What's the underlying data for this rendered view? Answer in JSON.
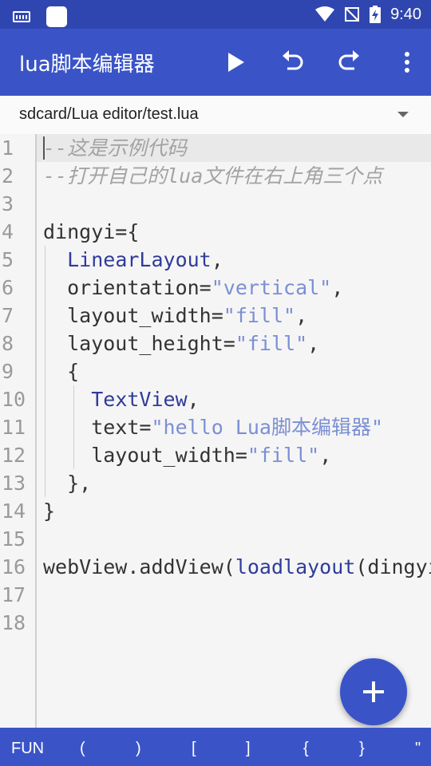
{
  "status_bar": {
    "time": "9:40",
    "icons": [
      "keyboard-icon",
      "app-square-icon",
      "wifi-icon",
      "no-signal-icon",
      "battery-charging-icon"
    ]
  },
  "toolbar": {
    "title": "lua脚本编辑器",
    "actions": [
      "play-icon",
      "undo-icon",
      "redo-icon",
      "more-vert-icon"
    ]
  },
  "file": {
    "path": "sdcard/Lua editor/test.lua"
  },
  "editor": {
    "line_numbers": [
      "1",
      "2",
      "3",
      "4",
      "5",
      "6",
      "7",
      "8",
      "9",
      "10",
      "11",
      "12",
      "13",
      "14",
      "15",
      "16",
      "17",
      "18"
    ],
    "lines": [
      [
        {
          "t": "--这是示例代码",
          "c": "cm"
        }
      ],
      [
        {
          "t": "--打开自己的lua文件在右上角三个点",
          "c": "cm"
        }
      ],
      [],
      [
        {
          "t": "dingyi={",
          "c": ""
        }
      ],
      [
        {
          "t": "  ",
          "c": ""
        },
        {
          "t": "LinearLayout",
          "c": "kw"
        },
        {
          "t": ",",
          "c": ""
        }
      ],
      [
        {
          "t": "  orientation=",
          "c": ""
        },
        {
          "t": "\"vertical\"",
          "c": "str"
        },
        {
          "t": ",",
          "c": ""
        }
      ],
      [
        {
          "t": "  layout_width=",
          "c": ""
        },
        {
          "t": "\"fill\"",
          "c": "str"
        },
        {
          "t": ",",
          "c": ""
        }
      ],
      [
        {
          "t": "  layout_height=",
          "c": ""
        },
        {
          "t": "\"fill\"",
          "c": "str"
        },
        {
          "t": ",",
          "c": ""
        }
      ],
      [
        {
          "t": "  {",
          "c": ""
        }
      ],
      [
        {
          "t": "    ",
          "c": ""
        },
        {
          "t": "TextView",
          "c": "kw"
        },
        {
          "t": ",",
          "c": ""
        }
      ],
      [
        {
          "t": "    text=",
          "c": ""
        },
        {
          "t": "\"hello Lua脚本编辑器\"",
          "c": "str"
        }
      ],
      [
        {
          "t": "    layout_width=",
          "c": ""
        },
        {
          "t": "\"fill\"",
          "c": "str"
        },
        {
          "t": ",",
          "c": ""
        }
      ],
      [
        {
          "t": "  },",
          "c": ""
        }
      ],
      [
        {
          "t": "}",
          "c": ""
        }
      ],
      [],
      [
        {
          "t": "webView.addView(",
          "c": ""
        },
        {
          "t": "loadlayout",
          "c": "kw"
        },
        {
          "t": "(dingyi))",
          "c": ""
        }
      ],
      [],
      []
    ]
  },
  "fab": {
    "icon": "plus-icon"
  },
  "symbol_bar": {
    "keys": [
      "FUN",
      "(",
      ")",
      "[",
      "]",
      "{",
      "}",
      "\""
    ]
  },
  "colors": {
    "primary": "#3a54c8",
    "primary_dark": "#2f46b0",
    "keyword": "#2f3b9a",
    "string": "#7b8fd4",
    "comment": "#a3a3a3"
  }
}
